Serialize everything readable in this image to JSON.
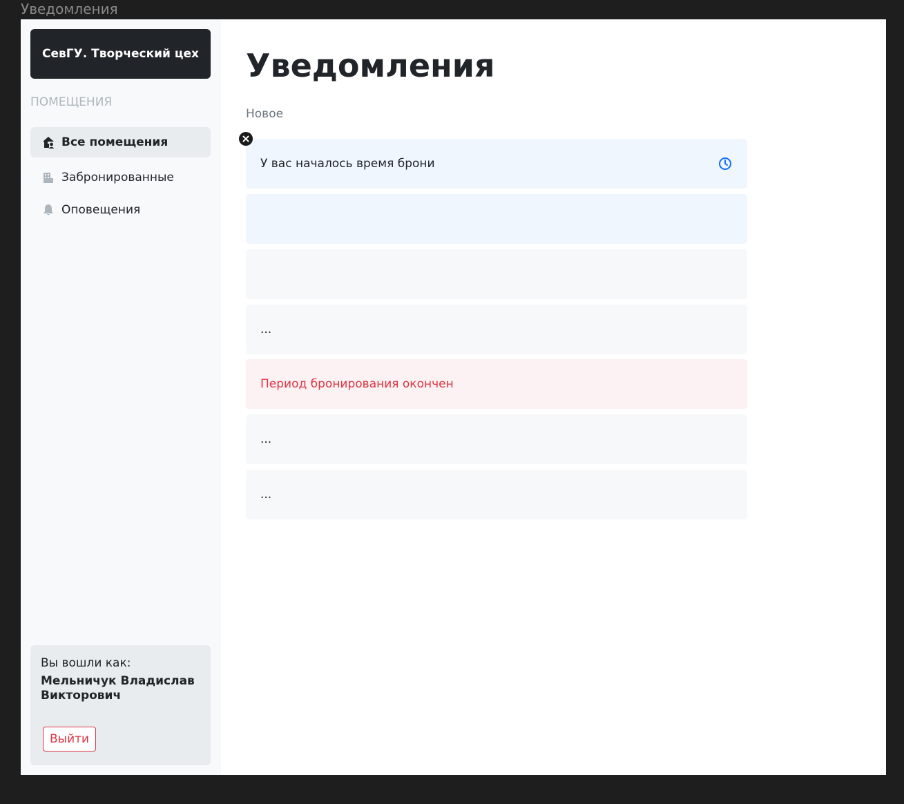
{
  "frame_title": "Уведомления",
  "sidebar": {
    "brand": "СевГУ. Творческий цех",
    "section_label": "ПОМЕЩЕНИЯ",
    "items": [
      {
        "label": "Все помещения",
        "icon": "house-user-icon",
        "active": true
      },
      {
        "label": "Забронированные",
        "icon": "building-icon",
        "active": false
      },
      {
        "label": "Оповещения",
        "icon": "bell-icon",
        "active": false
      }
    ],
    "user_card": {
      "login_label": "Вы вошли как:",
      "user_name": "Мельничук Владислав Викторович",
      "logout_label": "Выйти"
    }
  },
  "main": {
    "title": "Уведомления",
    "subheading": "Новое",
    "notifications": [
      {
        "text": "У вас  началось время брони",
        "variant": "info",
        "icon": "clock-icon"
      },
      {
        "text": "",
        "variant": "info"
      },
      {
        "text": "",
        "variant": "plain"
      },
      {
        "text": "...",
        "variant": "plain"
      },
      {
        "text": "Период бронирования окончен",
        "variant": "danger"
      },
      {
        "text": "...",
        "variant": "plain"
      },
      {
        "text": "...",
        "variant": "plain"
      }
    ]
  },
  "colors": {
    "brand_bg": "#212529",
    "accent_blue": "#0d6efd",
    "danger": "#dc3545",
    "info_bg": "#f0f6fd",
    "plain_bg": "#f7f8f9",
    "danger_bg": "#fdf2f3"
  }
}
